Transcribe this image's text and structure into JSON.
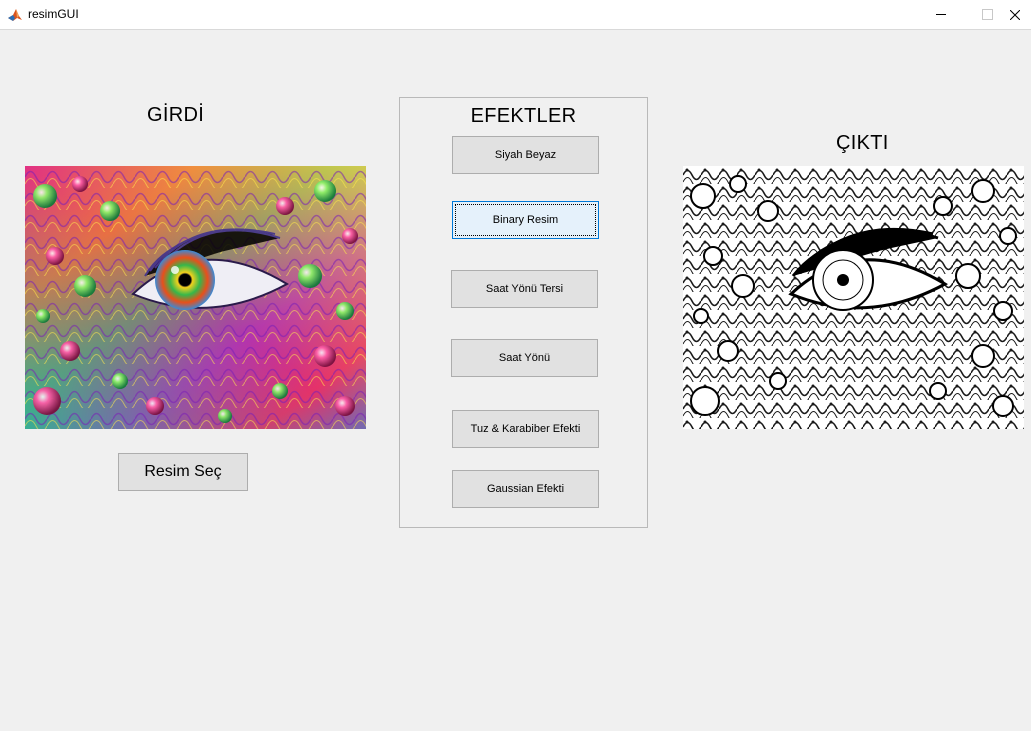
{
  "window": {
    "title": "resimGUI",
    "controls": {
      "minimize": "minimize-icon",
      "maximize": "maximize-icon",
      "close": "close-icon"
    }
  },
  "input_section": {
    "heading": "GİRDİ",
    "select_button_label": "Resim Seç"
  },
  "effects": {
    "title": "EFEKTLER",
    "buttons": [
      {
        "label": "Siyah Beyaz",
        "focused": false
      },
      {
        "label": "Binary Resim",
        "focused": true
      },
      {
        "label": "Saat Yönü Tersi",
        "focused": false
      },
      {
        "label": "Saat Yönü",
        "focused": false
      },
      {
        "label": "Tuz & Karabiber Efekti",
        "focused": false
      },
      {
        "label": "Gaussian Efekti",
        "focused": false
      }
    ]
  },
  "output_section": {
    "heading": "ÇIKTI"
  },
  "colors": {
    "background": "#f0f0f0",
    "button_face": "#e1e1e1",
    "focus_border": "#0078d7",
    "focus_fill": "#e5f1fb"
  }
}
